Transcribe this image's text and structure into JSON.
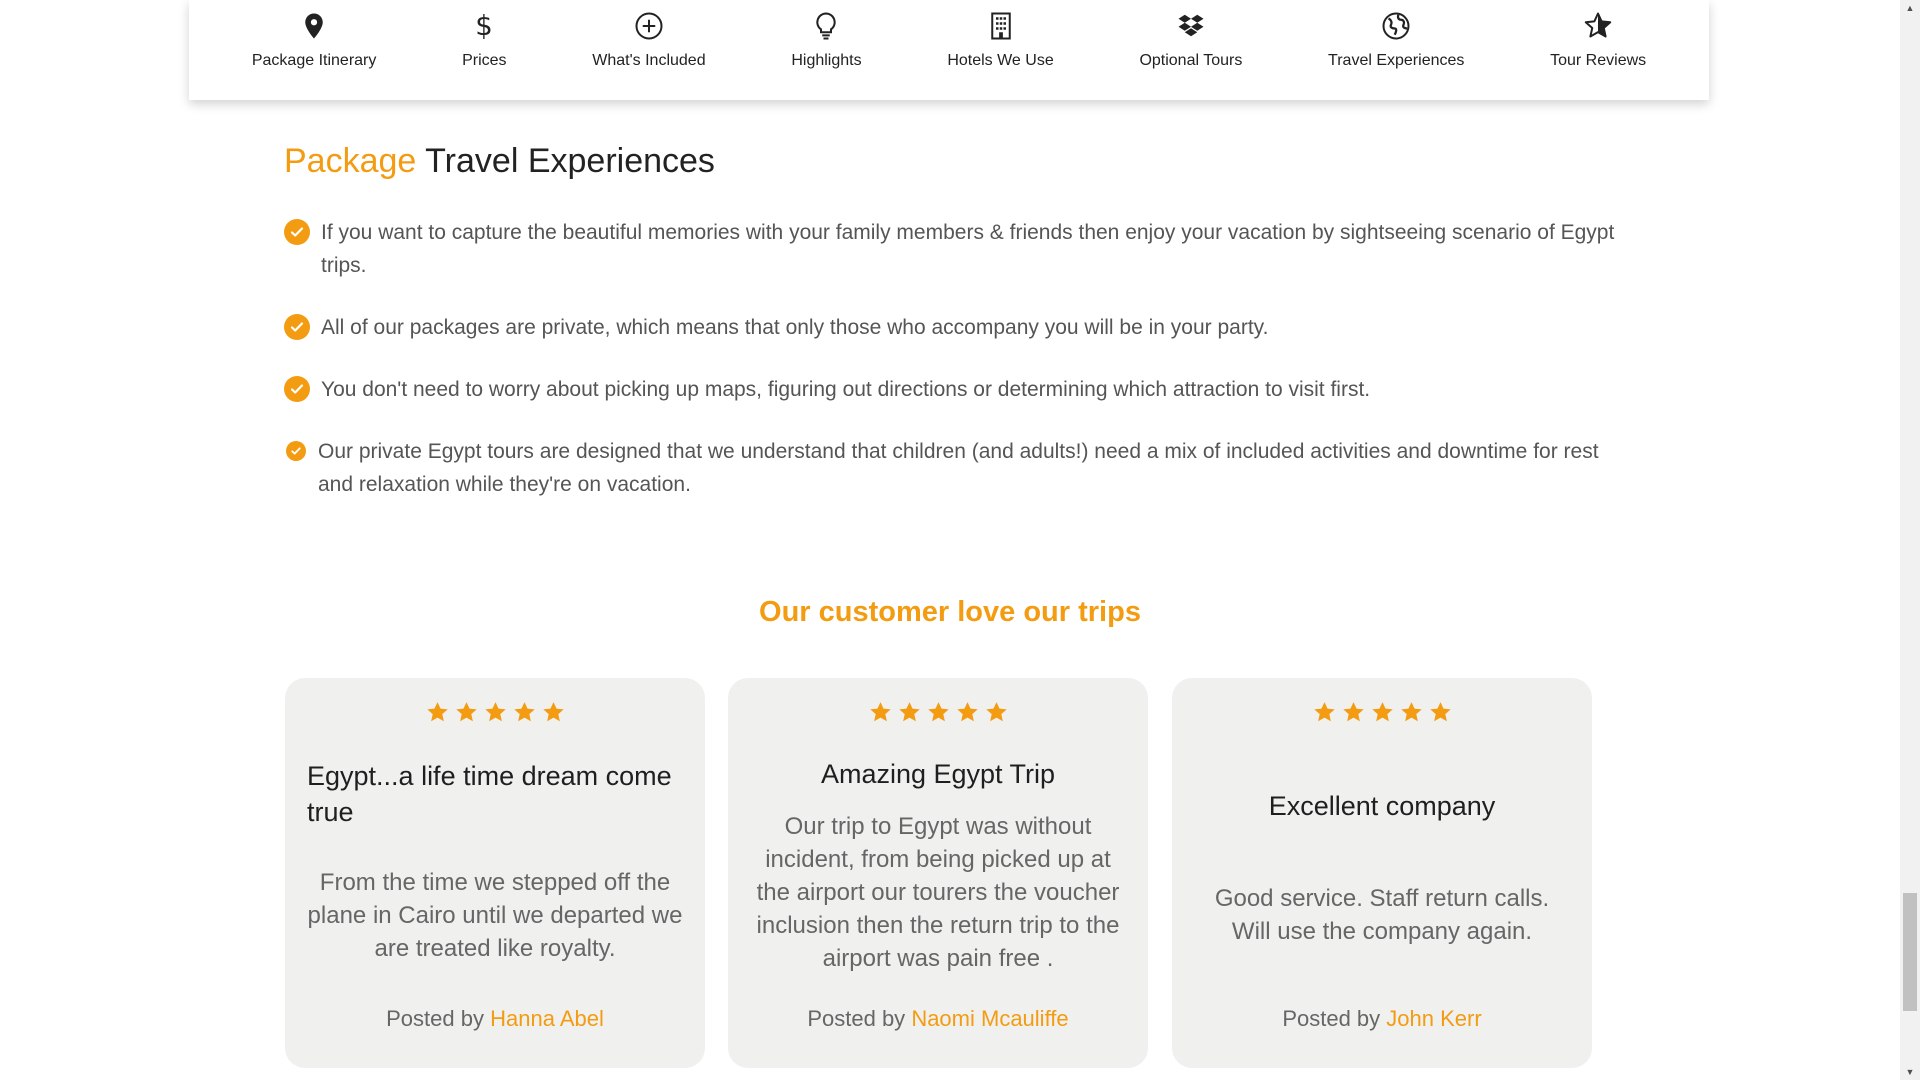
{
  "colors": {
    "accent": "#f39c12",
    "heading": "#222222",
    "body_text": "#555555",
    "card_bg": "#f0f0ef"
  },
  "tabs": [
    {
      "label": "Package Itinerary",
      "icon": "map-pin-icon"
    },
    {
      "label": "Prices",
      "icon": "dollar-icon"
    },
    {
      "label": "What's Included",
      "icon": "plus-circle-icon"
    },
    {
      "label": "Highlights",
      "icon": "lightbulb-icon"
    },
    {
      "label": "Hotels We Use",
      "icon": "building-icon"
    },
    {
      "label": "Optional Tours",
      "icon": "dropbox-icon"
    },
    {
      "label": "Travel Experiences",
      "icon": "globe-icon"
    },
    {
      "label": "Tour Reviews",
      "icon": "star-icon"
    }
  ],
  "experiences": {
    "title_accent": "Package",
    "title_rest": "Travel Experiences",
    "items": [
      "If you want to capture the beautiful memories with your family members & friends then enjoy your vacation by sightseeing scenario of Egypt trips.",
      "All of our packages are private, which means that only those who accompany you will be in your party.",
      "You don't need to worry about picking up maps, figuring out directions or determining which attraction to visit first.",
      "Our private Egypt tours are designed that we understand that children (and adults!) need a mix of included activities and downtime for rest and relaxation while they're on vacation."
    ]
  },
  "reviews": {
    "heading": "Our customer love our trips",
    "posted_by_label": "Posted by",
    "cards": [
      {
        "rating": 5,
        "title": "Egypt...a life time dream come true",
        "body": "From the time we stepped off the plane in Cairo until we departed we are treated like royalty.",
        "author": "Hanna Abel"
      },
      {
        "rating": 5,
        "title": "Amazing Egypt Trip",
        "body": "Our trip to Egypt was without incident, from being picked up at the airport our tourers the voucher inclusion then the return trip to the airport was pain free .",
        "author": "Naomi Mcauliffe"
      },
      {
        "rating": 5,
        "title": "Excellent company",
        "body": "Good service. Staff return calls. Will use the company again.",
        "author": "John Kerr"
      }
    ]
  }
}
